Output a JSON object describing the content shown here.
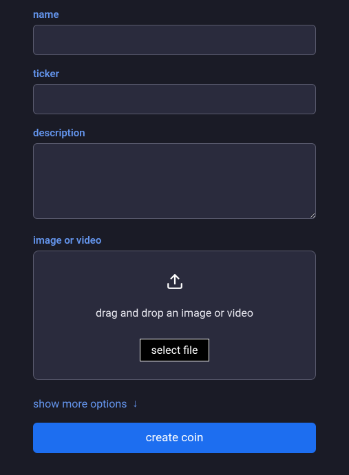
{
  "form": {
    "name": {
      "label": "name",
      "value": ""
    },
    "ticker": {
      "label": "ticker",
      "value": ""
    },
    "description": {
      "label": "description",
      "value": ""
    },
    "media": {
      "label": "image or video",
      "dropzone_text": "drag and drop an image or video",
      "select_button": "select file"
    },
    "more_options": {
      "label": "show more options",
      "arrow": "↓"
    },
    "submit": {
      "label": "create coin"
    }
  }
}
